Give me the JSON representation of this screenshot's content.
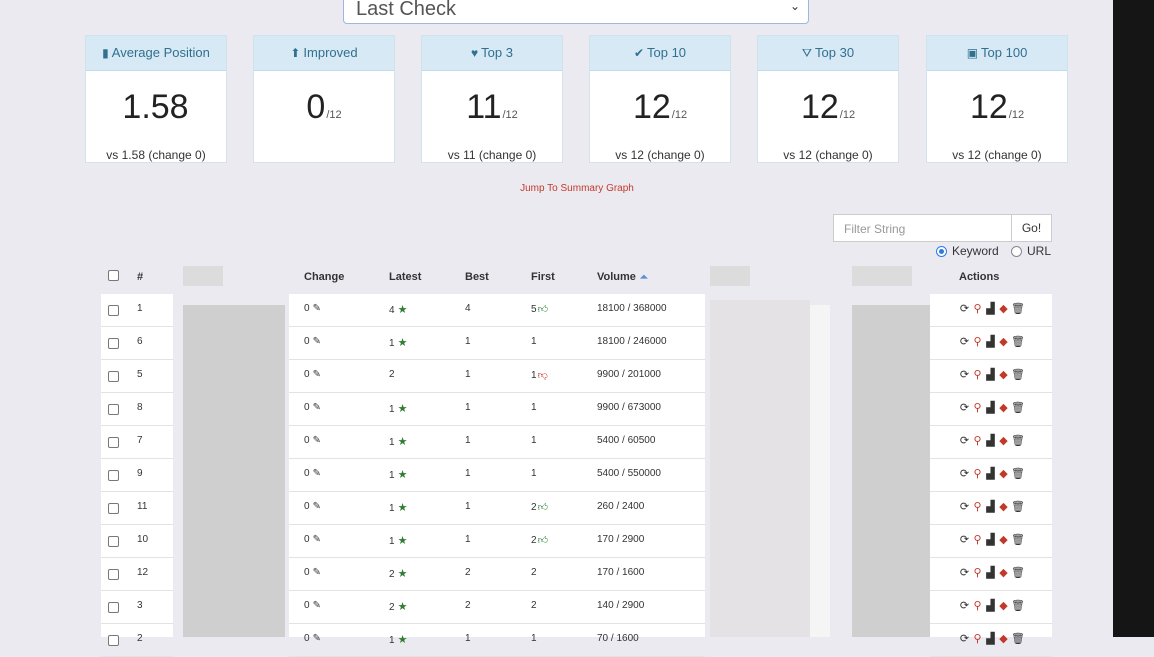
{
  "period_select": {
    "value": "Last Check"
  },
  "stats": [
    {
      "icon": "bar-chart-icon",
      "glyph": "▮",
      "title": "Average Position",
      "value": "1.58",
      "denom": "",
      "compare": "vs 1.58 (change 0)"
    },
    {
      "icon": "arrow-up-icon",
      "glyph": "⬆",
      "title": "Improved",
      "value": "0",
      "denom": "/12",
      "compare": ""
    },
    {
      "icon": "heart-icon",
      "glyph": "♥",
      "title": "Top 3",
      "value": "11",
      "denom": "/12",
      "compare": "vs 11 (change 0)"
    },
    {
      "icon": "check-icon",
      "glyph": "✔",
      "title": "Top 10",
      "value": "12",
      "denom": "/12",
      "compare": "vs 12 (change 0)"
    },
    {
      "icon": "road-icon",
      "glyph": "⛛",
      "title": "Top 30",
      "value": "12",
      "denom": "/12",
      "compare": "vs 12 (change 0)"
    },
    {
      "icon": "briefcase-icon",
      "glyph": "▣",
      "title": "Top 100",
      "value": "12",
      "denom": "/12",
      "compare": "vs 12 (change 0)"
    }
  ],
  "jump_link": "Jump To Summary Graph",
  "filter": {
    "placeholder": "Filter String",
    "go_label": "Go!",
    "radio_keyword": "Keyword",
    "radio_url": "URL",
    "selected": "keyword"
  },
  "table": {
    "headers": {
      "num": "#",
      "change": "Change",
      "latest": "Latest",
      "best": "Best",
      "first": "First",
      "volume": "Volume",
      "actions": "Actions"
    },
    "rows": [
      {
        "num": "1",
        "change": "0",
        "latest": "4",
        "latest_star": true,
        "best": "4",
        "first": "5",
        "first_thumb": "up",
        "volume": "18100 / 368000"
      },
      {
        "num": "6",
        "change": "0",
        "latest": "1",
        "latest_star": true,
        "best": "1",
        "first": "1",
        "first_thumb": "",
        "volume": "18100 / 246000"
      },
      {
        "num": "5",
        "change": "0",
        "latest": "2",
        "latest_star": false,
        "best": "1",
        "first": "1",
        "first_thumb": "down",
        "volume": "9900 / 201000"
      },
      {
        "num": "8",
        "change": "0",
        "latest": "1",
        "latest_star": true,
        "best": "1",
        "first": "1",
        "first_thumb": "",
        "volume": "9900 / 673000"
      },
      {
        "num": "7",
        "change": "0",
        "latest": "1",
        "latest_star": true,
        "best": "1",
        "first": "1",
        "first_thumb": "",
        "volume": "5400 / 60500"
      },
      {
        "num": "9",
        "change": "0",
        "latest": "1",
        "latest_star": true,
        "best": "1",
        "first": "1",
        "first_thumb": "",
        "volume": "5400 / 550000"
      },
      {
        "num": "11",
        "change": "0",
        "latest": "1",
        "latest_star": true,
        "best": "1",
        "first": "2",
        "first_thumb": "up",
        "volume": "260 / 2400"
      },
      {
        "num": "10",
        "change": "0",
        "latest": "1",
        "latest_star": true,
        "best": "1",
        "first": "2",
        "first_thumb": "up",
        "volume": "170 / 2900"
      },
      {
        "num": "12",
        "change": "0",
        "latest": "2",
        "latest_star": true,
        "best": "2",
        "first": "2",
        "first_thumb": "",
        "volume": "170 / 1600"
      },
      {
        "num": "3",
        "change": "0",
        "latest": "2",
        "latest_star": true,
        "best": "2",
        "first": "2",
        "first_thumb": "",
        "volume": "140 / 2900"
      },
      {
        "num": "2",
        "change": "0",
        "latest": "1",
        "latest_star": true,
        "best": "1",
        "first": "1",
        "first_thumb": "",
        "volume": "70 / 1600"
      }
    ]
  },
  "colors": {
    "accent": "#31708f",
    "link": "#c23b2c",
    "star": "#2e7d32"
  }
}
